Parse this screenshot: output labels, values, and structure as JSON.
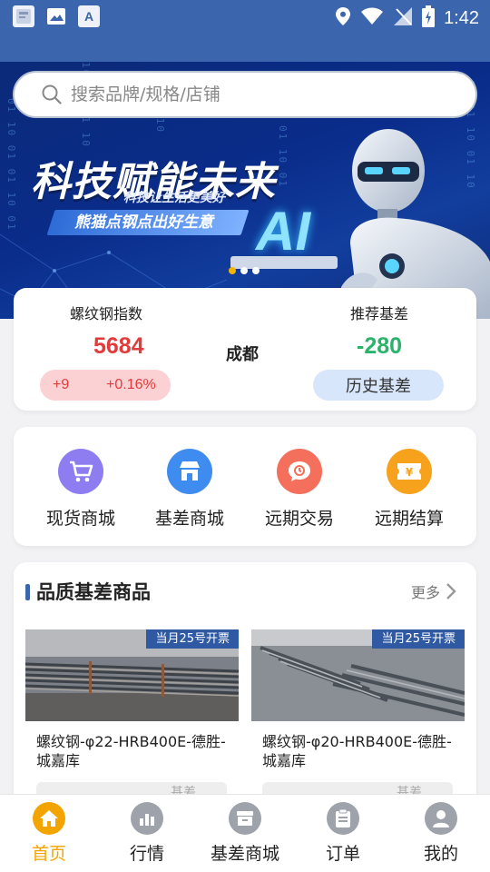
{
  "status_bar": {
    "time": "1:42",
    "left_icons": [
      "notification-app-icon",
      "image-icon",
      "text-a-icon"
    ],
    "text_icon_glyph": "A",
    "right_icons": [
      "location-icon",
      "wifi-icon",
      "no-signal-icon",
      "battery-icon"
    ]
  },
  "search": {
    "placeholder": "搜索品牌/规格/店铺"
  },
  "banner": {
    "title": "科技赋能未来",
    "subtitle": "科技让生活更美好",
    "slogan": "熊猫点钢点出好生意",
    "ai_text": "AI",
    "slides_count": 3,
    "active_slide": 1
  },
  "index_card": {
    "index_label": "螺纹钢指数",
    "index_value": "5684",
    "change_abs": "+9",
    "change_pct": "+0.16%",
    "city": "成都",
    "basis_label": "推荐基差",
    "basis_value": "-280",
    "history_button": "历史基差"
  },
  "quick_menu": [
    {
      "label": "现货商城",
      "icon": "cart-icon",
      "color": "#8e7df0"
    },
    {
      "label": "基差商城",
      "icon": "store-icon",
      "color": "#3e8cf0"
    },
    {
      "label": "远期交易",
      "icon": "chat-clock-icon",
      "color": "#f5705c"
    },
    {
      "label": "远期结算",
      "icon": "yen-ticket-icon",
      "color": "#f7a21c"
    }
  ],
  "products_section": {
    "title": "品质基差商品",
    "more_label": "更多",
    "items": [
      {
        "tag": "当月25号开票",
        "title": "螺纹钢-φ22-HRB400E-德胜-城嘉库",
        "button": "基差"
      },
      {
        "tag": "当月25号开票",
        "title": "螺纹钢-φ20-HRB400E-德胜-城嘉库",
        "button": "基差"
      }
    ]
  },
  "tab_bar": {
    "active_index": 0,
    "accent_color": "#f3a400",
    "tabs": [
      {
        "label": "首页",
        "icon": "home-icon"
      },
      {
        "label": "行情",
        "icon": "chart-icon"
      },
      {
        "label": "基差商城",
        "icon": "store-icon"
      },
      {
        "label": "订单",
        "icon": "clipboard-icon"
      },
      {
        "label": "我的",
        "icon": "user-icon"
      }
    ]
  }
}
